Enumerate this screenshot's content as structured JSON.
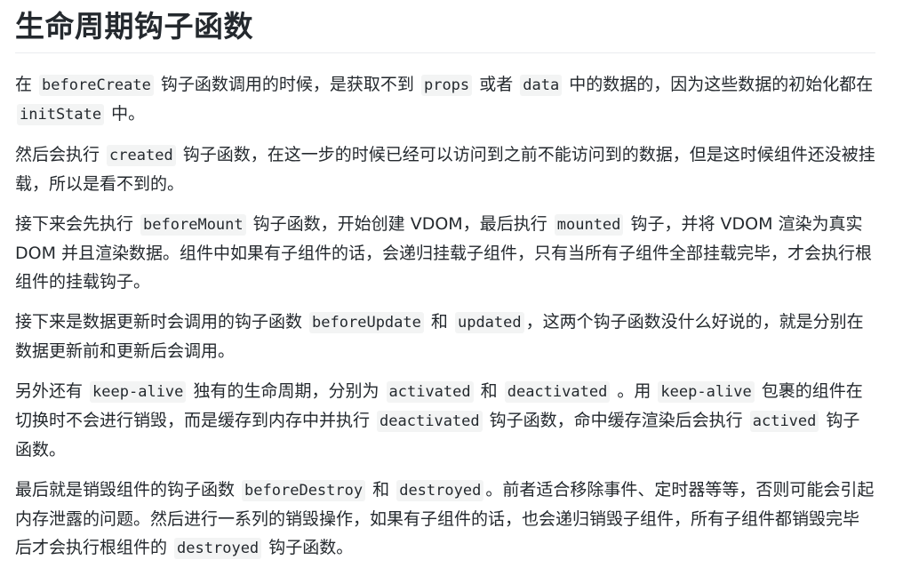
{
  "title": "生命周期钩子函数",
  "paragraphs": [
    [
      {
        "t": "text",
        "v": "在 "
      },
      {
        "t": "code",
        "v": "beforeCreate"
      },
      {
        "t": "text",
        "v": " 钩子函数调用的时候，是获取不到 "
      },
      {
        "t": "code",
        "v": "props"
      },
      {
        "t": "text",
        "v": " 或者 "
      },
      {
        "t": "code",
        "v": "data"
      },
      {
        "t": "text",
        "v": " 中的数据的，因为这些数据的初始化都在 "
      },
      {
        "t": "code",
        "v": "initState"
      },
      {
        "t": "text",
        "v": " 中。"
      }
    ],
    [
      {
        "t": "text",
        "v": "然后会执行 "
      },
      {
        "t": "code",
        "v": "created"
      },
      {
        "t": "text",
        "v": " 钩子函数，在这一步的时候已经可以访问到之前不能访问到的数据，但是这时候组件还没被挂载，所以是看不到的。"
      }
    ],
    [
      {
        "t": "text",
        "v": "接下来会先执行 "
      },
      {
        "t": "code",
        "v": "beforeMount"
      },
      {
        "t": "text",
        "v": " 钩子函数，开始创建 VDOM，最后执行 "
      },
      {
        "t": "code",
        "v": "mounted"
      },
      {
        "t": "text",
        "v": " 钩子，并将 VDOM 渲染为真实 DOM 并且渲染数据。组件中如果有子组件的话，会递归挂载子组件，只有当所有子组件全部挂载完毕，才会执行根组件的挂载钩子。"
      }
    ],
    [
      {
        "t": "text",
        "v": "接下来是数据更新时会调用的钩子函数 "
      },
      {
        "t": "code",
        "v": "beforeUpdate"
      },
      {
        "t": "text",
        "v": " 和 "
      },
      {
        "t": "code",
        "v": "updated"
      },
      {
        "t": "text",
        "v": "，这两个钩子函数没什么好说的，就是分别在数据更新前和更新后会调用。"
      }
    ],
    [
      {
        "t": "text",
        "v": "另外还有 "
      },
      {
        "t": "code",
        "v": "keep-alive"
      },
      {
        "t": "text",
        "v": " 独有的生命周期，分别为 "
      },
      {
        "t": "code",
        "v": "activated"
      },
      {
        "t": "text",
        "v": " 和 "
      },
      {
        "t": "code",
        "v": "deactivated"
      },
      {
        "t": "text",
        "v": " 。用 "
      },
      {
        "t": "code",
        "v": "keep-alive"
      },
      {
        "t": "text",
        "v": " 包裹的组件在切换时不会进行销毁，而是缓存到内存中并执行 "
      },
      {
        "t": "code",
        "v": "deactivated"
      },
      {
        "t": "text",
        "v": " 钩子函数，命中缓存渲染后会执行 "
      },
      {
        "t": "code",
        "v": "actived"
      },
      {
        "t": "text",
        "v": " 钩子函数。"
      }
    ],
    [
      {
        "t": "text",
        "v": "最后就是销毁组件的钩子函数 "
      },
      {
        "t": "code",
        "v": "beforeDestroy"
      },
      {
        "t": "text",
        "v": " 和 "
      },
      {
        "t": "code",
        "v": "destroyed"
      },
      {
        "t": "text",
        "v": "。前者适合移除事件、定时器等等，否则可能会引起内存泄露的问题。然后进行一系列的销毁操作，如果有子组件的话，也会递归销毁子组件，所有子组件都销毁完毕后才会执行根组件的 "
      },
      {
        "t": "code",
        "v": "destroyed"
      },
      {
        "t": "text",
        "v": " 钩子函数。"
      }
    ]
  ]
}
